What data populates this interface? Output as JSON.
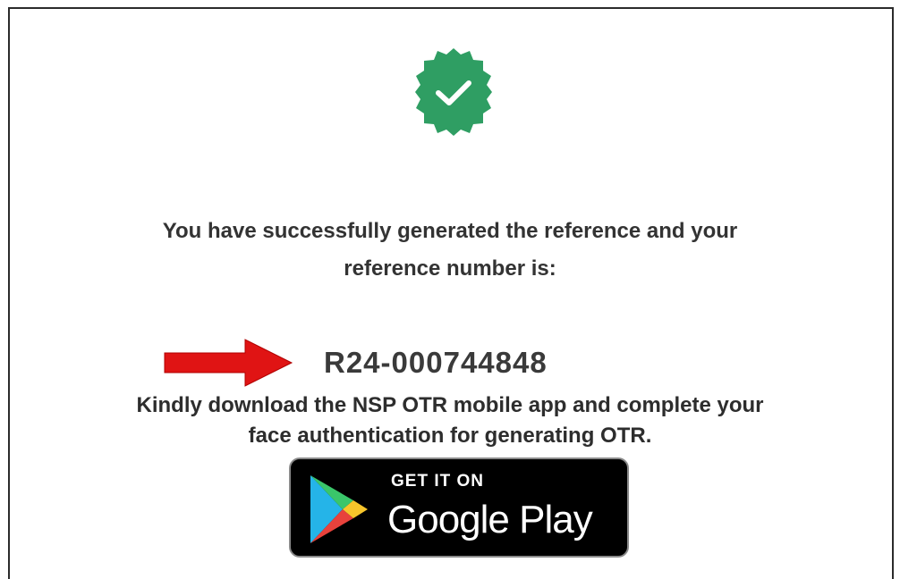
{
  "success": {
    "message_line1": "You have successfully generated the reference and your",
    "message_line2": "reference number is:",
    "reference_number": "R24-000744848"
  },
  "instruction": {
    "line1": "Kindly download the NSP OTR mobile app and complete your",
    "line2": "face authentication for generating OTR."
  },
  "store_badge": {
    "small_label": "GET IT ON",
    "big_label": "Google Play"
  },
  "colors": {
    "badge_green": "#2f9e63",
    "arrow_red": "#e01414",
    "text_dark": "#333333",
    "store_bg": "#000000"
  },
  "icons": {
    "success_badge": "check-badge-icon",
    "pointer": "arrow-right-icon",
    "store_logo": "google-play-icon"
  }
}
